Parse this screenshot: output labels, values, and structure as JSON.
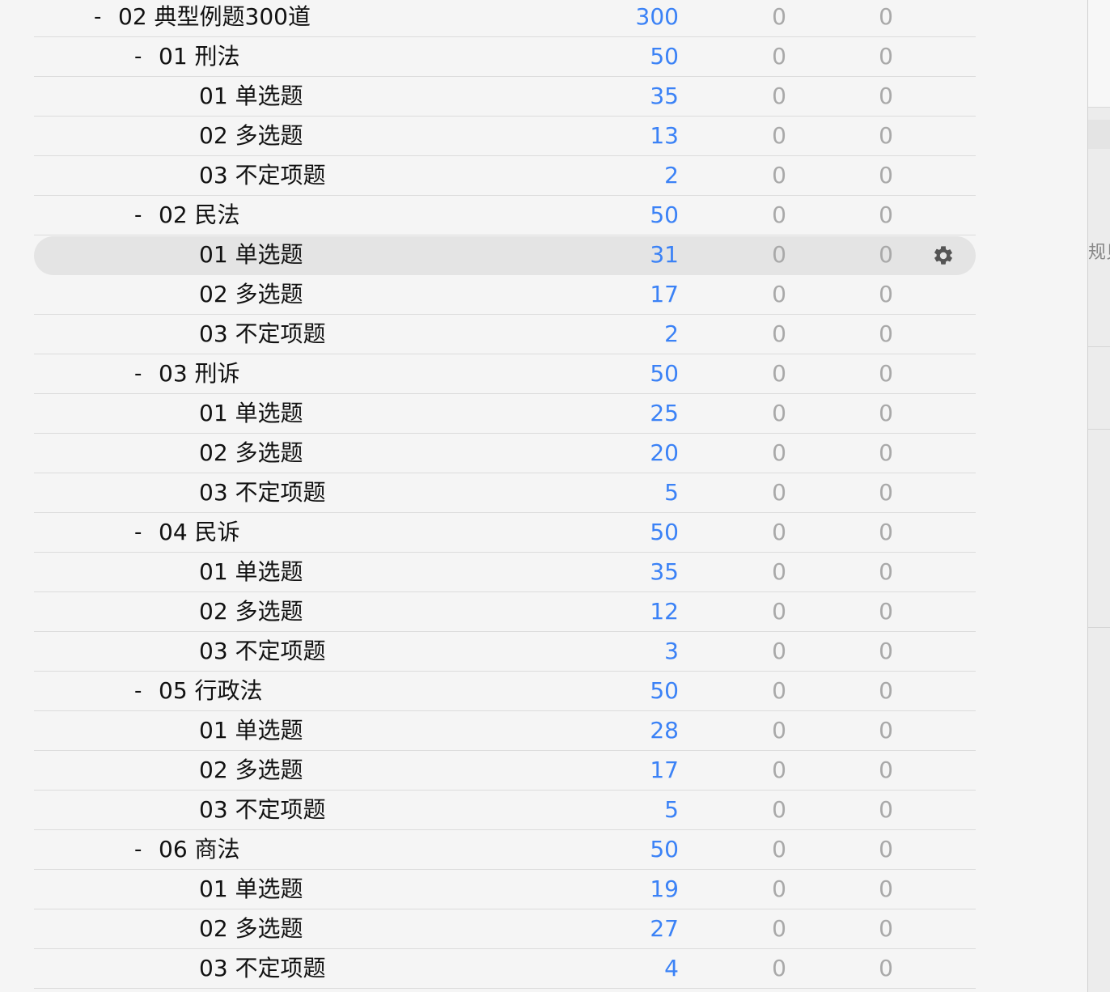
{
  "deck": {
    "rows": [
      {
        "toggle": "-",
        "name": "02 典型例题300道",
        "new": "300",
        "learn": "0",
        "due": "0"
      },
      {
        "toggle": "-",
        "name": "01 刑法",
        "new": "50",
        "learn": "0",
        "due": "0"
      },
      {
        "toggle": "",
        "name": "01 单选题",
        "new": "35",
        "learn": "0",
        "due": "0"
      },
      {
        "toggle": "",
        "name": "02 多选题",
        "new": "13",
        "learn": "0",
        "due": "0"
      },
      {
        "toggle": "",
        "name": "03 不定项题",
        "new": "2",
        "learn": "0",
        "due": "0"
      },
      {
        "toggle": "-",
        "name": "02 民法",
        "new": "50",
        "learn": "0",
        "due": "0"
      },
      {
        "toggle": "",
        "name": "01 单选题",
        "new": "31",
        "learn": "0",
        "due": "0"
      },
      {
        "toggle": "",
        "name": "02 多选题",
        "new": "17",
        "learn": "0",
        "due": "0"
      },
      {
        "toggle": "",
        "name": "03 不定项题",
        "new": "2",
        "learn": "0",
        "due": "0"
      },
      {
        "toggle": "-",
        "name": "03 刑诉",
        "new": "50",
        "learn": "0",
        "due": "0"
      },
      {
        "toggle": "",
        "name": "01 单选题",
        "new": "25",
        "learn": "0",
        "due": "0"
      },
      {
        "toggle": "",
        "name": "02 多选题",
        "new": "20",
        "learn": "0",
        "due": "0"
      },
      {
        "toggle": "",
        "name": "03 不定项题",
        "new": "5",
        "learn": "0",
        "due": "0"
      },
      {
        "toggle": "-",
        "name": "04 民诉",
        "new": "50",
        "learn": "0",
        "due": "0"
      },
      {
        "toggle": "",
        "name": "01 单选题",
        "new": "35",
        "learn": "0",
        "due": "0"
      },
      {
        "toggle": "",
        "name": "02 多选题",
        "new": "12",
        "learn": "0",
        "due": "0"
      },
      {
        "toggle": "",
        "name": "03 不定项题",
        "new": "3",
        "learn": "0",
        "due": "0"
      },
      {
        "toggle": "-",
        "name": "05 行政法",
        "new": "50",
        "learn": "0",
        "due": "0"
      },
      {
        "toggle": "",
        "name": "01 单选题",
        "new": "28",
        "learn": "0",
        "due": "0"
      },
      {
        "toggle": "",
        "name": "02 多选题",
        "new": "17",
        "learn": "0",
        "due": "0"
      },
      {
        "toggle": "",
        "name": "03 不定项题",
        "new": "5",
        "learn": "0",
        "due": "0"
      },
      {
        "toggle": "-",
        "name": "06 商法",
        "new": "50",
        "learn": "0",
        "due": "0"
      },
      {
        "toggle": "",
        "name": "01 单选题",
        "new": "19",
        "learn": "0",
        "due": "0"
      },
      {
        "toggle": "",
        "name": "02 多选题",
        "new": "27",
        "learn": "0",
        "due": "0"
      },
      {
        "toggle": "",
        "name": "03 不定项题",
        "new": "4",
        "learn": "0",
        "due": "0"
      }
    ],
    "selected_index": 6,
    "gear_icon": "gear-icon"
  },
  "side_panel": {
    "clipped_text": "规贝"
  },
  "colors": {
    "new_count": "#3b82f6",
    "zero_count": "#a9a9a9",
    "selected_row": "#e4e4e4"
  }
}
